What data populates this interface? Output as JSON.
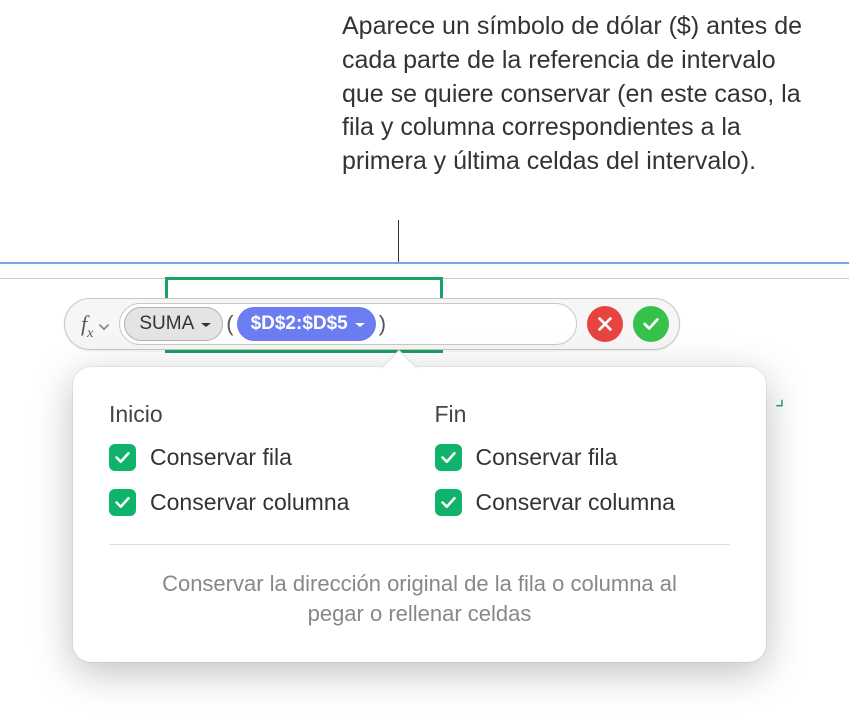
{
  "annotation": "Aparece un símbolo de dólar ($) antes de cada parte de la referencia de intervalo que se quiere conservar (en este caso, la fila y columna correspondientes a la primera y última celdas del intervalo).",
  "formula_bar": {
    "function_name": "SUMA",
    "reference": "$D$2:$D$5"
  },
  "popover": {
    "start": {
      "header": "Inicio",
      "preserve_row": "Conservar fila",
      "preserve_column": "Conservar columna"
    },
    "end": {
      "header": "Fin",
      "preserve_row": "Conservar fila",
      "preserve_column": "Conservar columna"
    },
    "footer": "Conservar la dirección original de la fila o columna al pegar o rellenar celdas"
  }
}
